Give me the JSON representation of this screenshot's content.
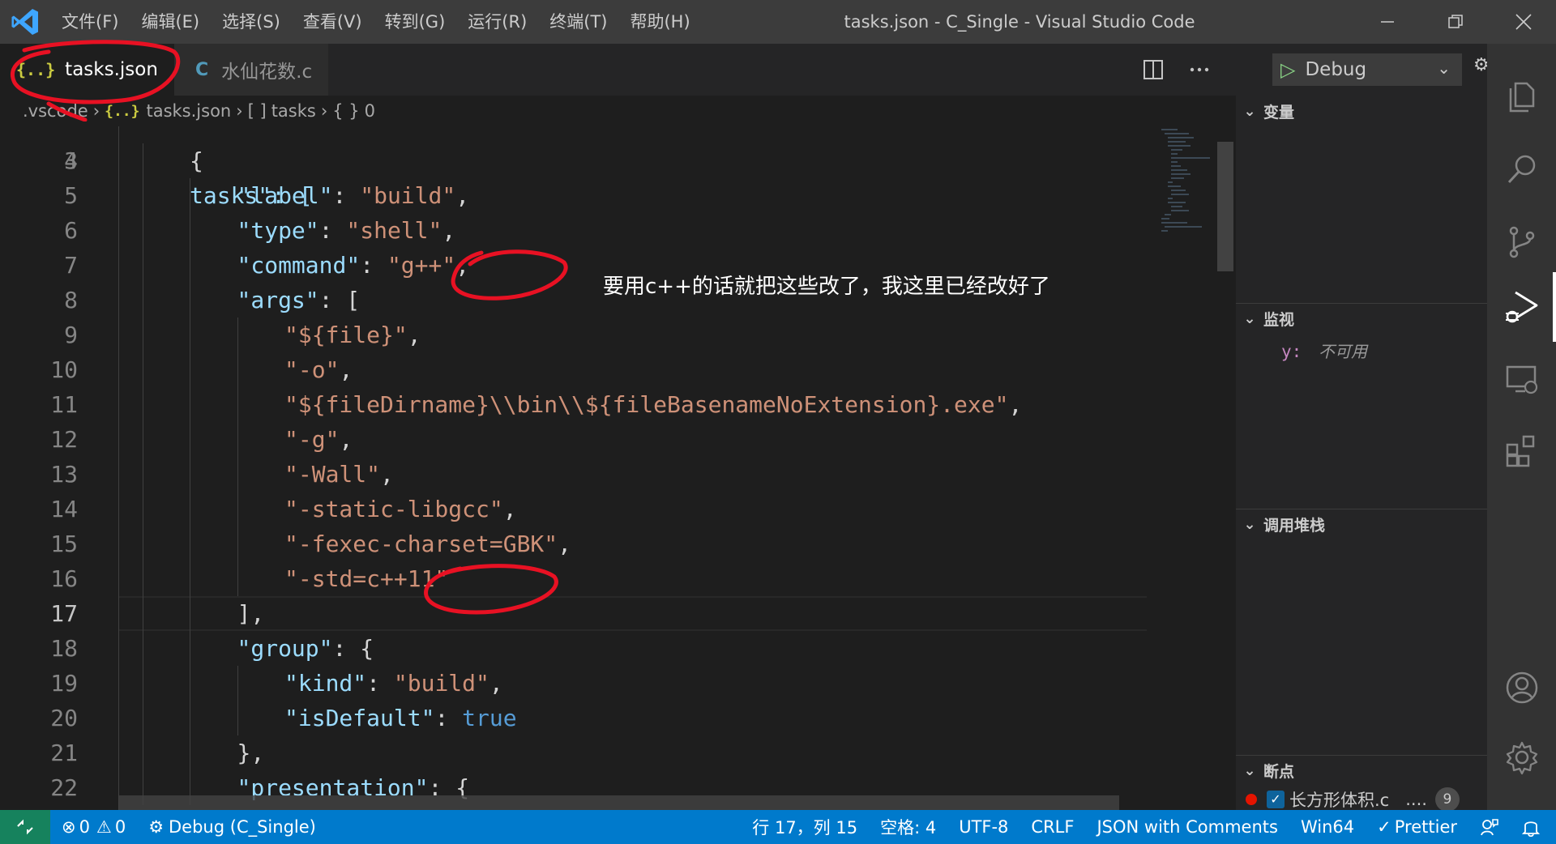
{
  "window": {
    "title": "tasks.json - C_Single - Visual Studio Code",
    "menus": [
      "文件(F)",
      "编辑(E)",
      "选择(S)",
      "查看(V)",
      "转到(G)",
      "运行(R)",
      "终端(T)",
      "帮助(H)"
    ]
  },
  "tabs": [
    {
      "icon": "{..}",
      "label": "tasks.json",
      "close": "✕"
    },
    {
      "icon": "C",
      "label": "水仙花数.c"
    }
  ],
  "breadcrumb": {
    "folder": ".vscode",
    "json_icon": "{..}",
    "file": "tasks.json",
    "array_icon": "[ ]",
    "array": "tasks",
    "obj_icon": "{ }",
    "obj": "0"
  },
  "editor": {
    "partial_line": "tasks\": [",
    "partial_line_number": "3",
    "current_line": "17",
    "lines": [
      {
        "n": "4",
        "indent": 2,
        "tokens": [
          [
            "punc",
            "{"
          ]
        ]
      },
      {
        "n": "5",
        "indent": 3,
        "tokens": [
          [
            "key",
            "\"label\""
          ],
          [
            "punc",
            ": "
          ],
          [
            "str",
            "\"build\""
          ],
          [
            "punc",
            ","
          ]
        ]
      },
      {
        "n": "6",
        "indent": 3,
        "tokens": [
          [
            "key",
            "\"type\""
          ],
          [
            "punc",
            ": "
          ],
          [
            "str",
            "\"shell\""
          ],
          [
            "punc",
            ","
          ]
        ]
      },
      {
        "n": "7",
        "indent": 3,
        "tokens": [
          [
            "key",
            "\"command\""
          ],
          [
            "punc",
            ": "
          ],
          [
            "str",
            "\"g++\""
          ],
          [
            "punc",
            ","
          ]
        ]
      },
      {
        "n": "8",
        "indent": 3,
        "tokens": [
          [
            "key",
            "\"args\""
          ],
          [
            "punc",
            ": ["
          ]
        ]
      },
      {
        "n": "9",
        "indent": 4,
        "tokens": [
          [
            "str",
            "\"${file}\""
          ],
          [
            "punc",
            ","
          ]
        ]
      },
      {
        "n": "10",
        "indent": 4,
        "tokens": [
          [
            "str",
            "\"-o\""
          ],
          [
            "punc",
            ","
          ]
        ]
      },
      {
        "n": "11",
        "indent": 4,
        "tokens": [
          [
            "str",
            "\"${fileDirname}\\\\bin\\\\${fileBasenameNoExtension}.exe\""
          ],
          [
            "punc",
            ","
          ]
        ]
      },
      {
        "n": "12",
        "indent": 4,
        "tokens": [
          [
            "str",
            "\"-g\""
          ],
          [
            "punc",
            ","
          ]
        ]
      },
      {
        "n": "13",
        "indent": 4,
        "tokens": [
          [
            "str",
            "\"-Wall\""
          ],
          [
            "punc",
            ","
          ]
        ]
      },
      {
        "n": "14",
        "indent": 4,
        "tokens": [
          [
            "str",
            "\"-static-libgcc\""
          ],
          [
            "punc",
            ","
          ]
        ]
      },
      {
        "n": "15",
        "indent": 4,
        "tokens": [
          [
            "str",
            "\"-fexec-charset=GBK\""
          ],
          [
            "punc",
            ","
          ]
        ]
      },
      {
        "n": "16",
        "indent": 4,
        "tokens": [
          [
            "str",
            "\"-std=c++11\""
          ]
        ]
      },
      {
        "n": "17",
        "indent": 3,
        "tokens": [
          [
            "punc",
            "],"
          ]
        ]
      },
      {
        "n": "18",
        "indent": 3,
        "tokens": [
          [
            "key",
            "\"group\""
          ],
          [
            "punc",
            ": {"
          ]
        ]
      },
      {
        "n": "19",
        "indent": 4,
        "tokens": [
          [
            "key",
            "\"kind\""
          ],
          [
            "punc",
            ": "
          ],
          [
            "str",
            "\"build\""
          ],
          [
            "punc",
            ","
          ]
        ]
      },
      {
        "n": "20",
        "indent": 4,
        "tokens": [
          [
            "key",
            "\"isDefault\""
          ],
          [
            "punc",
            ": "
          ],
          [
            "bool",
            "true"
          ]
        ]
      },
      {
        "n": "21",
        "indent": 3,
        "tokens": [
          [
            "punc",
            "},"
          ]
        ]
      },
      {
        "n": "22",
        "indent": 3,
        "tokens": [
          [
            "key",
            "\"presentation\""
          ],
          [
            "punc",
            ": {"
          ]
        ]
      }
    ]
  },
  "annotation": "要用c++的话就把这些改了，我这里已经改好了",
  "debug": {
    "play_icon": "▷",
    "config": "Debug",
    "sections": {
      "variables": "变量",
      "watch": "监视",
      "callstack": "调用堆栈",
      "breakpoints": "断点"
    },
    "watch_item": {
      "name": "y:",
      "value": "不可用"
    },
    "breakpoint": {
      "file": "长方形体积.c",
      "more": "....",
      "count": "9"
    }
  },
  "statusbar": {
    "errors": "0",
    "warnings": "0",
    "debug": "Debug (C_Single)",
    "position": "行 17，列 15",
    "spaces": "空格: 4",
    "encoding": "UTF-8",
    "eol": "CRLF",
    "language": "JSON with Comments",
    "platform": "Win64",
    "formatter": "Prettier"
  },
  "colors": {
    "accent": "#007acc",
    "annotation_red": "#e81123"
  }
}
